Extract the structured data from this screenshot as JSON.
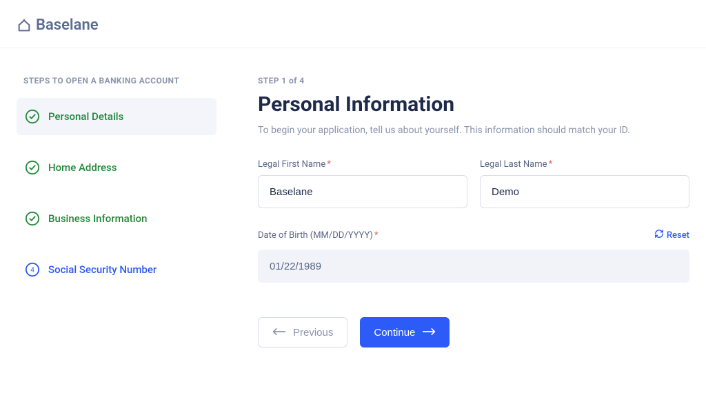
{
  "brand": {
    "name": "Baselane"
  },
  "sidebar": {
    "heading": "STEPS TO OPEN A BANKING ACCOUNT",
    "steps": [
      {
        "label": "Personal Details"
      },
      {
        "label": "Home Address"
      },
      {
        "label": "Business Information"
      },
      {
        "label": "Social Security Number",
        "number": "4"
      }
    ]
  },
  "content": {
    "step_counter": "STEP 1 of 4",
    "title": "Personal Information",
    "subtitle": "To begin your application, tell us about yourself. This information should match your ID.",
    "first_name_label": "Legal First Name",
    "first_name_value": "Baselane",
    "last_name_label": "Legal Last Name",
    "last_name_value": "Demo",
    "dob_label": "Date of Birth (MM/DD/YYYY)",
    "dob_value": "01/22/1989",
    "reset_label": "Reset",
    "previous_label": "Previous",
    "continue_label": "Continue"
  }
}
